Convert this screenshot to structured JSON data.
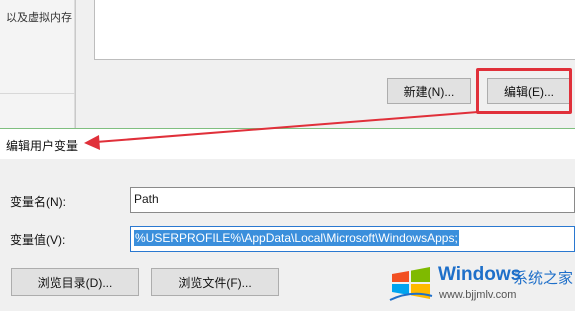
{
  "background_window": {
    "text": "以及虚拟内存"
  },
  "env_dialog": {
    "new_button": "新建(N)...",
    "edit_button": "编辑(E)..."
  },
  "edit_dialog": {
    "title": "编辑用户变量",
    "name_label": "变量名(N):",
    "name_value": "Path",
    "value_label": "变量值(V):",
    "value_value": "%USERPROFILE%\\AppData\\Local\\Microsoft\\WindowsApps;",
    "browse_dir_button": "浏览目录(D)...",
    "browse_file_button": "浏览文件(F)..."
  },
  "annotation": {
    "highlight_color": "#e0303a"
  },
  "watermark": {
    "brand": "Windows",
    "brand_cn": "系统之家",
    "url": "www.bjjmlv.com",
    "colors": [
      "#f25022",
      "#7fba00",
      "#00a4ef",
      "#ffb900"
    ]
  }
}
